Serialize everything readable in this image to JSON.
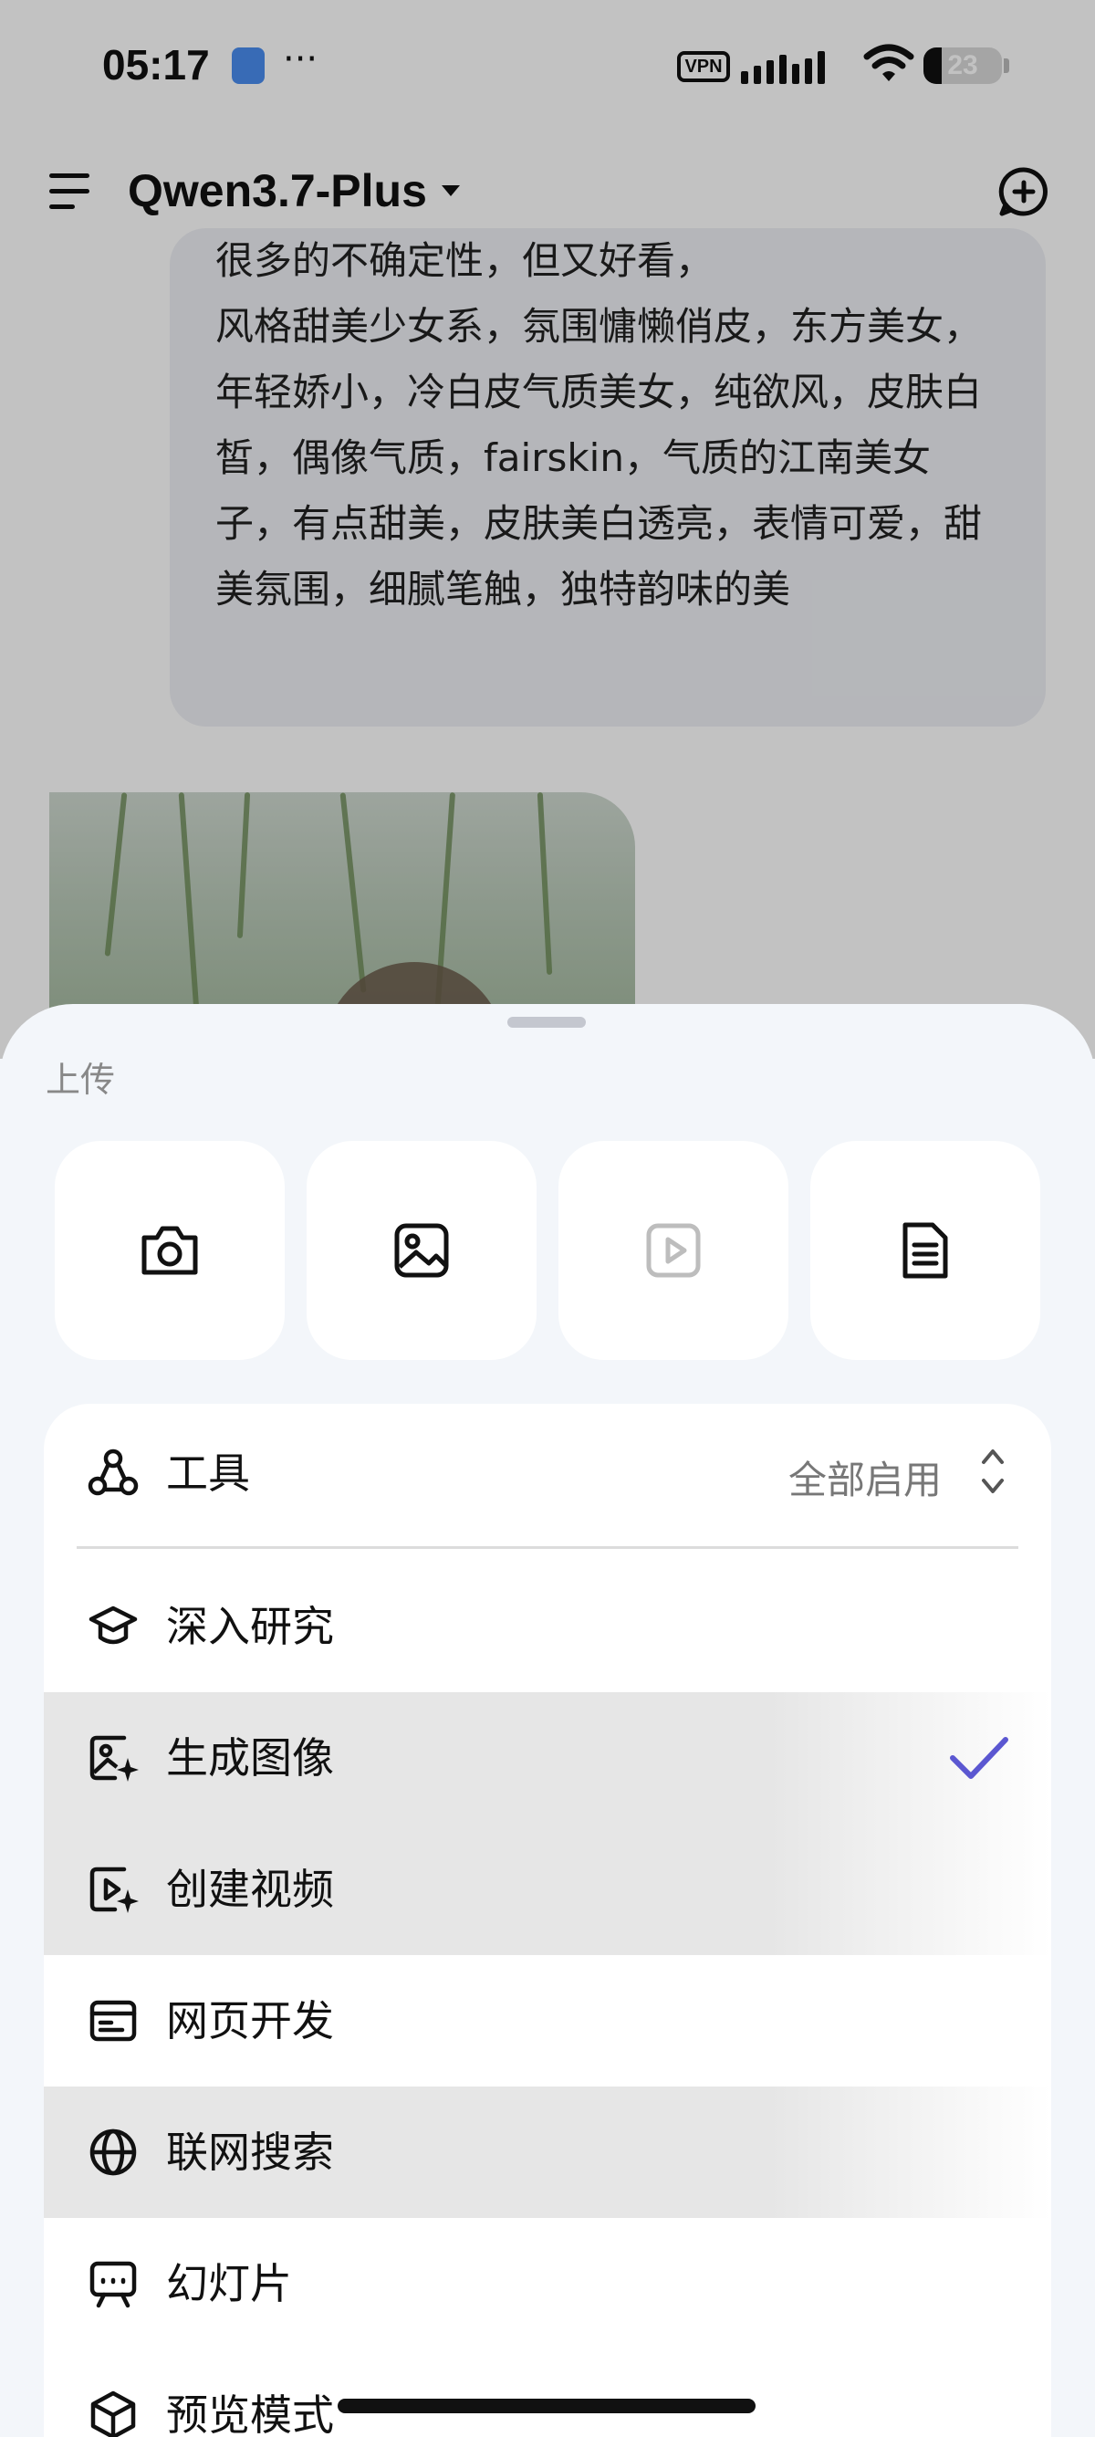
{
  "status_bar": {
    "time": "05:17",
    "more": "···",
    "vpn": "VPN",
    "battery": "23",
    "battery_level": 0.23
  },
  "header": {
    "model_name": "Qwen3.7-Plus"
  },
  "chat": {
    "user_message": "很多的不确定性，但又好看，\n风格甜美少女系，氛围慵懒俏皮，东方美女，年轻娇小，冷白皮气质美女，纯欲风，皮肤白皙，偶像气质，fairskin，气质的江南美女子，有点甜美，皮肤美白透亮，表情可爱，甜美氛围，细腻笔触，独特韵味的美"
  },
  "sheet": {
    "upload_label": "上传",
    "upload_tiles": [
      {
        "icon": "camera-icon"
      },
      {
        "icon": "image-icon"
      },
      {
        "icon": "video-icon",
        "disabled": true
      },
      {
        "icon": "document-icon"
      }
    ],
    "tools": {
      "label": "工具",
      "value": "全部启用"
    },
    "items": [
      {
        "label": "深入研究",
        "icon": "graduation-cap-icon",
        "selected": false
      },
      {
        "label": "生成图像",
        "icon": "image-sparkle-icon",
        "selected": true
      },
      {
        "label": "创建视频",
        "icon": "video-sparkle-icon",
        "selected": false
      },
      {
        "label": "网页开发",
        "icon": "web-browser-icon",
        "selected": false
      },
      {
        "label": "联网搜索",
        "icon": "globe-icon",
        "selected": false
      },
      {
        "label": "幻灯片",
        "icon": "presentation-icon",
        "selected": false
      },
      {
        "label": "预览模式",
        "icon": "cube-icon",
        "selected": false
      }
    ],
    "accent_color": "#5b57d1"
  }
}
